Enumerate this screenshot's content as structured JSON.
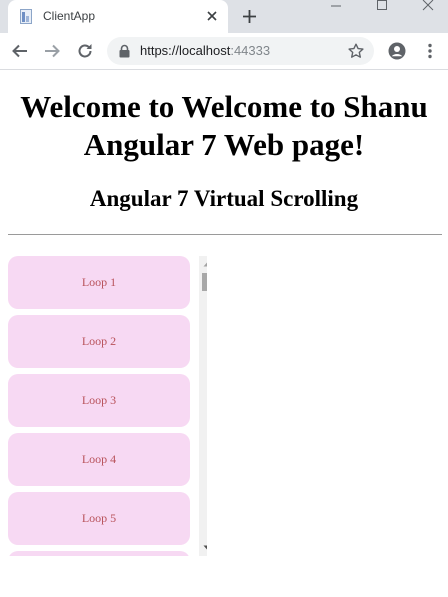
{
  "browser": {
    "tab_title": "ClientApp",
    "url_main": "https://localhost",
    "url_port": ":44333"
  },
  "page": {
    "title": "Welcome to Welcome to Shanu Angular 7 Web page!",
    "subtitle": "Angular 7 Virtual Scrolling"
  },
  "list": {
    "items": [
      "Loop 1",
      "Loop 2",
      "Loop 3",
      "Loop 4",
      "Loop 5",
      ""
    ]
  },
  "colors": {
    "item_background": "#f7d9f3",
    "item_text": "#b8525a"
  }
}
